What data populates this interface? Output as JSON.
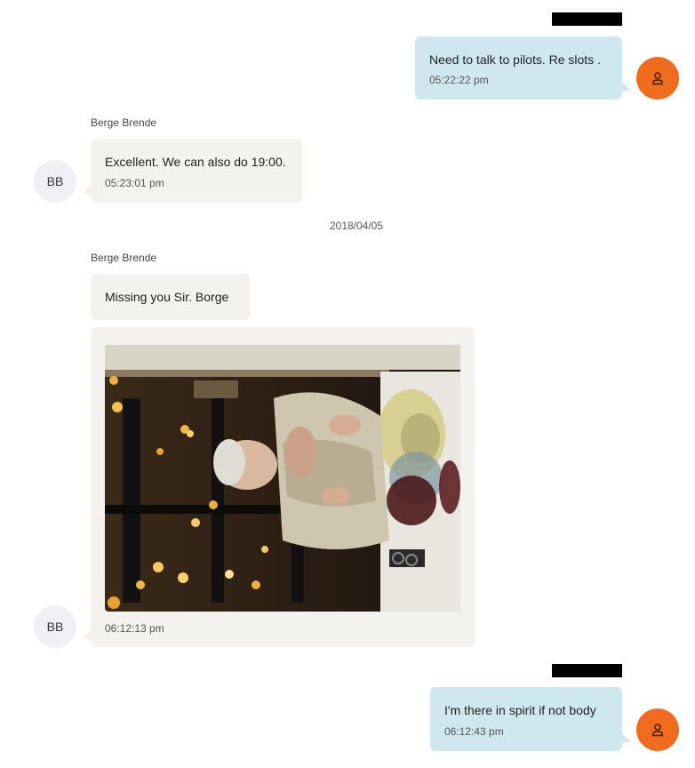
{
  "messages": [
    {
      "direction": "outgoing",
      "text": "Need to talk to pilots. Re slots .",
      "time": "05:22:22 pm"
    },
    {
      "direction": "incoming",
      "sender": "Berge Brende",
      "avatar_initials": "BB",
      "text": "Excellent. We can also do 19:00.",
      "time": "05:23:01 pm"
    },
    {
      "date_separator": "2018/04/05"
    },
    {
      "direction": "incoming",
      "sender": "Berge Brende",
      "text": "Missing you Sir. Borge"
    },
    {
      "direction": "incoming",
      "type": "photo",
      "avatar_initials": "BB",
      "time": "06:12:13 pm"
    },
    {
      "direction": "outgoing",
      "text": "I'm there in spirit if not body",
      "time": "06:12:43 pm"
    }
  ],
  "icons": {
    "my_avatar": "user-icon"
  },
  "colors": {
    "outgoing_bubble": "#cfe8ef",
    "incoming_bubble": "#f3f2ef",
    "my_avatar": "#ef6b1d",
    "contact_avatar": "#f0eff4",
    "redaction": "#000000"
  }
}
